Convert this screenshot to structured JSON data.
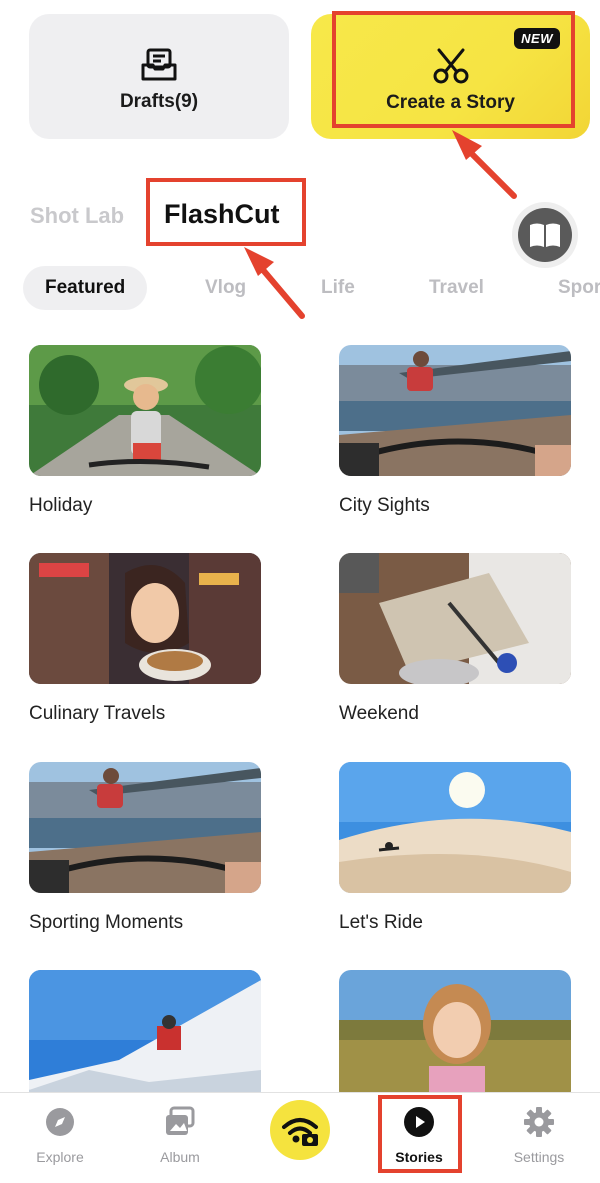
{
  "top_cards": {
    "drafts_label": "Drafts(9)",
    "create_story_label": "Create a Story",
    "new_badge": "NEW"
  },
  "section_tabs": {
    "shot_lab": "Shot Lab",
    "flashcut": "FlashCut"
  },
  "categories": [
    "Featured",
    "Vlog",
    "Life",
    "Travel",
    "Spor"
  ],
  "templates": [
    {
      "title": "Holiday"
    },
    {
      "title": "City Sights"
    },
    {
      "title": "Culinary Travels"
    },
    {
      "title": "Weekend"
    },
    {
      "title": "Sporting Moments"
    },
    {
      "title": "Let's Ride"
    }
  ],
  "bottom_nav": {
    "explore": "Explore",
    "album": "Album",
    "stories": "Stories",
    "settings": "Settings"
  },
  "colors": {
    "accent_yellow": "#f5e33e",
    "annotation_red": "#e4422e"
  }
}
